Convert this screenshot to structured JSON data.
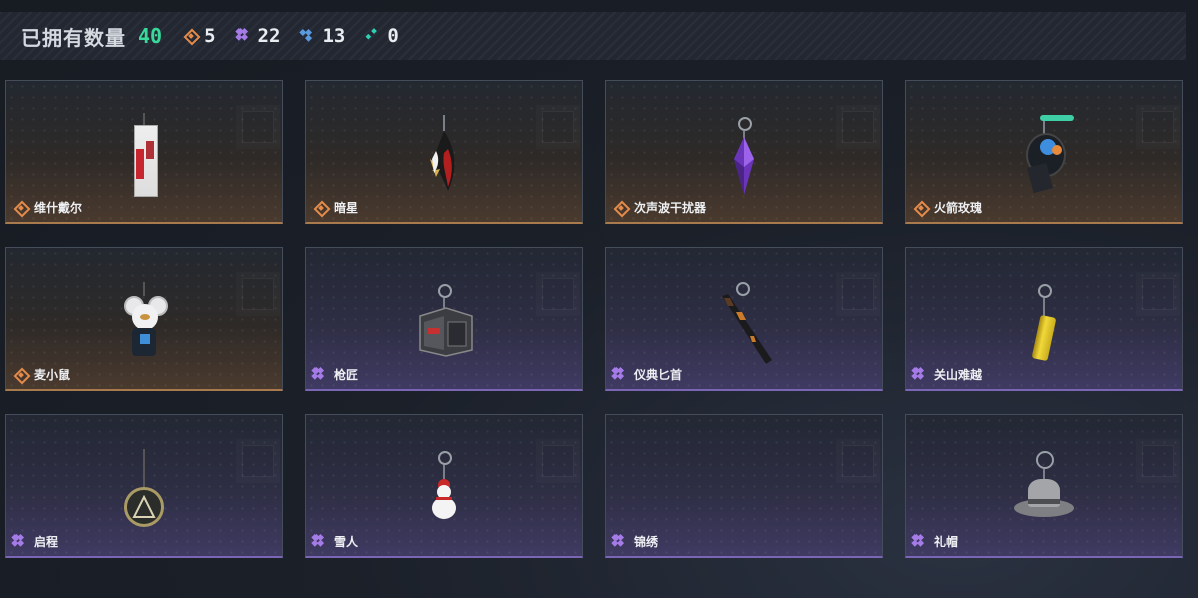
{
  "header": {
    "title": "已拥有数量",
    "count": "40",
    "stats": [
      {
        "icon": "orange-diamond-icon",
        "value": "5"
      },
      {
        "icon": "purple-cluster-icon",
        "value": "22"
      },
      {
        "icon": "blue-cluster-icon",
        "value": "13"
      },
      {
        "icon": "teal-dots-icon",
        "value": "0"
      }
    ]
  },
  "colors": {
    "orange": "#e58b4a",
    "purple": "#a57be8",
    "blue": "#5a9be0",
    "teal": "#2fd1b5",
    "count_green": "#38d99a"
  },
  "items": [
    {
      "name": "维什戴尔",
      "rarity": "orange",
      "icon": "card-charm-icon"
    },
    {
      "name": "暗星",
      "rarity": "orange",
      "icon": "feather-charm-icon"
    },
    {
      "name": "次声波干扰器",
      "rarity": "orange",
      "icon": "crystal-charm-icon"
    },
    {
      "name": "火箭玫瑰",
      "rarity": "orange",
      "icon": "rocket-charm-icon"
    },
    {
      "name": "麦小鼠",
      "rarity": "orange",
      "icon": "mouse-charm-icon"
    },
    {
      "name": "枪匠",
      "rarity": "purple",
      "icon": "workshop-charm-icon"
    },
    {
      "name": "仪典匕首",
      "rarity": "purple",
      "icon": "dagger-charm-icon"
    },
    {
      "name": "关山难越",
      "rarity": "purple",
      "icon": "can-charm-icon"
    },
    {
      "name": "启程",
      "rarity": "purple",
      "icon": "medal-charm-icon"
    },
    {
      "name": "雪人",
      "rarity": "purple",
      "icon": "snowman-charm-icon"
    },
    {
      "name": "锦绣",
      "rarity": "purple",
      "icon": "empty-charm-icon"
    },
    {
      "name": "礼帽",
      "rarity": "purple",
      "icon": "hat-charm-icon"
    }
  ]
}
